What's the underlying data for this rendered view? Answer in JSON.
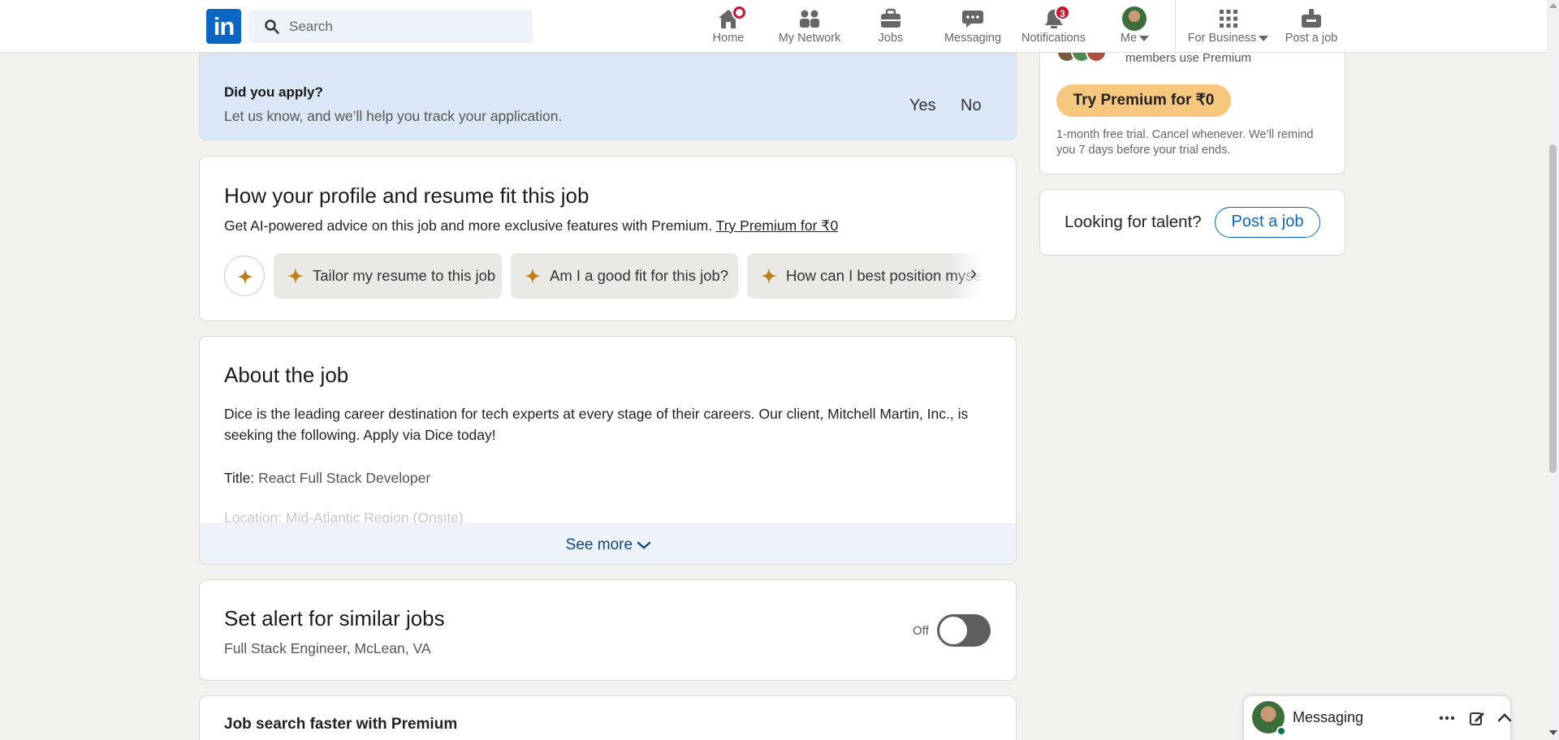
{
  "nav": {
    "logo": "in",
    "search_placeholder": "Search",
    "items": [
      {
        "label": "Home"
      },
      {
        "label": "My Network"
      },
      {
        "label": "Jobs"
      },
      {
        "label": "Messaging"
      },
      {
        "label": "Notifications",
        "badge": "3"
      },
      {
        "label": "Me"
      },
      {
        "label": "For Business"
      },
      {
        "label": "Post a job"
      }
    ]
  },
  "apply_prompt": {
    "title": "Did you apply?",
    "subtitle": "Let us know, and we’ll help you track your application.",
    "yes": "Yes",
    "no": "No"
  },
  "profile_fit": {
    "title": "How your profile and resume fit this job",
    "description": "Get AI-powered advice on this job and more exclusive features with Premium.",
    "premium_link": "Try Premium for ₹0",
    "chips": [
      "Tailor my resume to this job",
      "Am I a good fit for this job?",
      "How can I best position myself for this job?"
    ],
    "next_glyph": "›"
  },
  "about": {
    "title": "About the job",
    "intro": "Dice is the leading career destination for tech experts at every stage of their careers. Our client, Mitchell Martin, Inc., is",
    "intro2": "seeking the following. Apply via Dice today!",
    "title_label": "Title:",
    "title_value": "React Full Stack Developer",
    "location_label": "Location:",
    "location_value": "Mid-Atlantic Region (Onsite)",
    "see_more": "See more"
  },
  "alert": {
    "title": "Set alert for similar jobs",
    "subtitle": "Full Stack Engineer, McLean, VA",
    "toggle_label": "Off",
    "toggle_state": false
  },
  "premium_section": {
    "title": "Job search faster with Premium"
  },
  "right_rail": {
    "premium_text": "members use Premium",
    "premium_button": "Try Premium for ₹0",
    "premium_note": "1-month free trial. Cancel whenever. We’ll remind you 7 days before your trial ends.",
    "talent_label": "Looking for talent?",
    "post_job_button": "Post a job"
  },
  "messaging_dock": {
    "title": "Messaging"
  },
  "colors": {
    "brand": "#0a66c2",
    "premium": "#f8c77e",
    "badge": "#cb112d",
    "sparkle": "#c37d16"
  }
}
